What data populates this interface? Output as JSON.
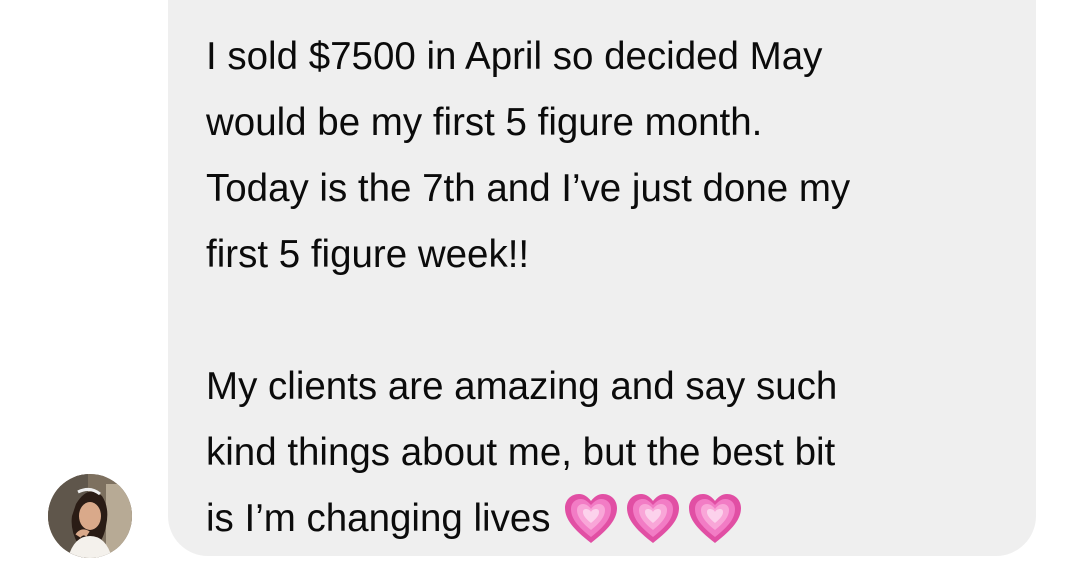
{
  "message": {
    "lines": [
      "I sold $7500 in April so decided May",
      "would be my first 5 figure month.",
      "Today is the 7th and I’ve just done my",
      "first 5 figure week!!",
      "",
      "My clients are amazing and say such",
      "kind things about me, but the best bit",
      "is I’m changing lives"
    ],
    "emoji": [
      "growing-heart-icon",
      "growing-heart-icon",
      "growing-heart-icon"
    ],
    "bubble_color": "#efefef",
    "text_color": "#0b0b0b",
    "heart_color": "#ee5fb8"
  },
  "sender": {
    "avatar_icon": "avatar"
  }
}
